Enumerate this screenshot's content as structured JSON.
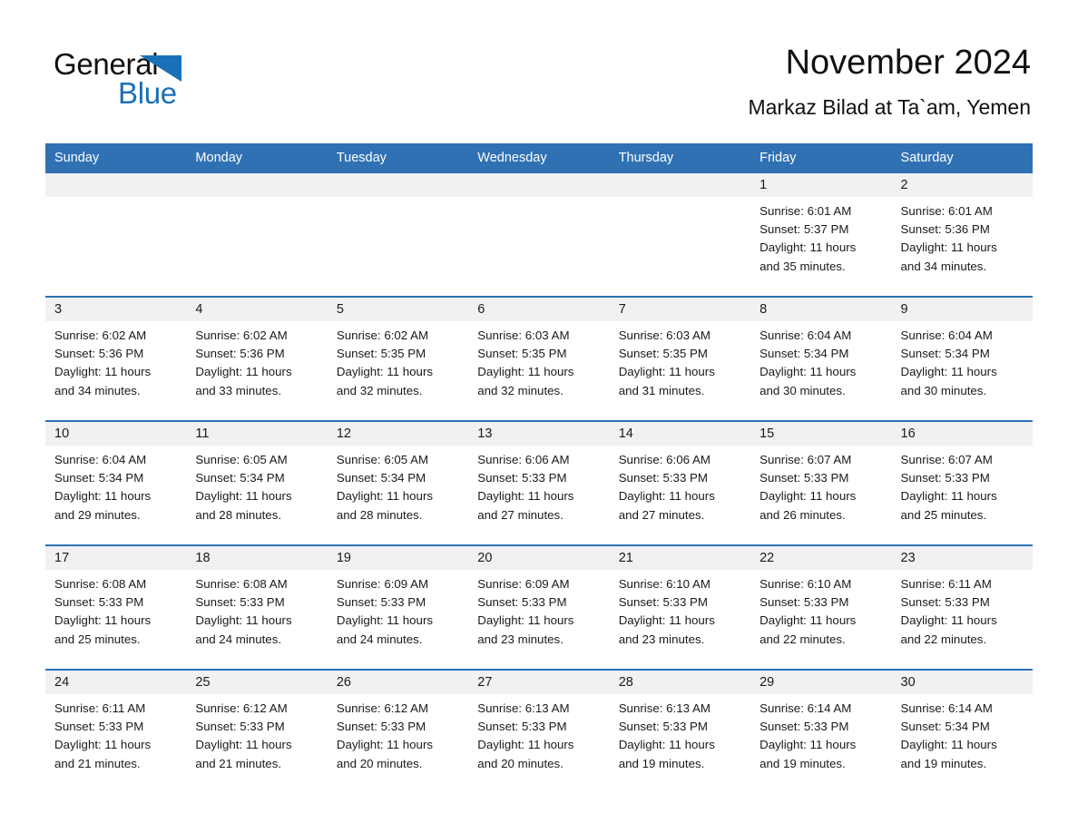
{
  "brand": {
    "name_part1": "General",
    "name_part2": "Blue",
    "triangle_color": "#1a70b8"
  },
  "header": {
    "title": "November 2024",
    "subtitle": "Markaz Bilad at Ta`am, Yemen"
  },
  "colors": {
    "header_blue": "#3071b4",
    "day_band_gray": "#f1f1f1",
    "text": "#1a1a1a"
  },
  "weekdays": [
    "Sunday",
    "Monday",
    "Tuesday",
    "Wednesday",
    "Thursday",
    "Friday",
    "Saturday"
  ],
  "weeks": [
    [
      {
        "day": "",
        "sunrise": "",
        "sunset": "",
        "daylight1": "",
        "daylight2": ""
      },
      {
        "day": "",
        "sunrise": "",
        "sunset": "",
        "daylight1": "",
        "daylight2": ""
      },
      {
        "day": "",
        "sunrise": "",
        "sunset": "",
        "daylight1": "",
        "daylight2": ""
      },
      {
        "day": "",
        "sunrise": "",
        "sunset": "",
        "daylight1": "",
        "daylight2": ""
      },
      {
        "day": "",
        "sunrise": "",
        "sunset": "",
        "daylight1": "",
        "daylight2": ""
      },
      {
        "day": "1",
        "sunrise": "Sunrise: 6:01 AM",
        "sunset": "Sunset: 5:37 PM",
        "daylight1": "Daylight: 11 hours",
        "daylight2": "and 35 minutes."
      },
      {
        "day": "2",
        "sunrise": "Sunrise: 6:01 AM",
        "sunset": "Sunset: 5:36 PM",
        "daylight1": "Daylight: 11 hours",
        "daylight2": "and 34 minutes."
      }
    ],
    [
      {
        "day": "3",
        "sunrise": "Sunrise: 6:02 AM",
        "sunset": "Sunset: 5:36 PM",
        "daylight1": "Daylight: 11 hours",
        "daylight2": "and 34 minutes."
      },
      {
        "day": "4",
        "sunrise": "Sunrise: 6:02 AM",
        "sunset": "Sunset: 5:36 PM",
        "daylight1": "Daylight: 11 hours",
        "daylight2": "and 33 minutes."
      },
      {
        "day": "5",
        "sunrise": "Sunrise: 6:02 AM",
        "sunset": "Sunset: 5:35 PM",
        "daylight1": "Daylight: 11 hours",
        "daylight2": "and 32 minutes."
      },
      {
        "day": "6",
        "sunrise": "Sunrise: 6:03 AM",
        "sunset": "Sunset: 5:35 PM",
        "daylight1": "Daylight: 11 hours",
        "daylight2": "and 32 minutes."
      },
      {
        "day": "7",
        "sunrise": "Sunrise: 6:03 AM",
        "sunset": "Sunset: 5:35 PM",
        "daylight1": "Daylight: 11 hours",
        "daylight2": "and 31 minutes."
      },
      {
        "day": "8",
        "sunrise": "Sunrise: 6:04 AM",
        "sunset": "Sunset: 5:34 PM",
        "daylight1": "Daylight: 11 hours",
        "daylight2": "and 30 minutes."
      },
      {
        "day": "9",
        "sunrise": "Sunrise: 6:04 AM",
        "sunset": "Sunset: 5:34 PM",
        "daylight1": "Daylight: 11 hours",
        "daylight2": "and 30 minutes."
      }
    ],
    [
      {
        "day": "10",
        "sunrise": "Sunrise: 6:04 AM",
        "sunset": "Sunset: 5:34 PM",
        "daylight1": "Daylight: 11 hours",
        "daylight2": "and 29 minutes."
      },
      {
        "day": "11",
        "sunrise": "Sunrise: 6:05 AM",
        "sunset": "Sunset: 5:34 PM",
        "daylight1": "Daylight: 11 hours",
        "daylight2": "and 28 minutes."
      },
      {
        "day": "12",
        "sunrise": "Sunrise: 6:05 AM",
        "sunset": "Sunset: 5:34 PM",
        "daylight1": "Daylight: 11 hours",
        "daylight2": "and 28 minutes."
      },
      {
        "day": "13",
        "sunrise": "Sunrise: 6:06 AM",
        "sunset": "Sunset: 5:33 PM",
        "daylight1": "Daylight: 11 hours",
        "daylight2": "and 27 minutes."
      },
      {
        "day": "14",
        "sunrise": "Sunrise: 6:06 AM",
        "sunset": "Sunset: 5:33 PM",
        "daylight1": "Daylight: 11 hours",
        "daylight2": "and 27 minutes."
      },
      {
        "day": "15",
        "sunrise": "Sunrise: 6:07 AM",
        "sunset": "Sunset: 5:33 PM",
        "daylight1": "Daylight: 11 hours",
        "daylight2": "and 26 minutes."
      },
      {
        "day": "16",
        "sunrise": "Sunrise: 6:07 AM",
        "sunset": "Sunset: 5:33 PM",
        "daylight1": "Daylight: 11 hours",
        "daylight2": "and 25 minutes."
      }
    ],
    [
      {
        "day": "17",
        "sunrise": "Sunrise: 6:08 AM",
        "sunset": "Sunset: 5:33 PM",
        "daylight1": "Daylight: 11 hours",
        "daylight2": "and 25 minutes."
      },
      {
        "day": "18",
        "sunrise": "Sunrise: 6:08 AM",
        "sunset": "Sunset: 5:33 PM",
        "daylight1": "Daylight: 11 hours",
        "daylight2": "and 24 minutes."
      },
      {
        "day": "19",
        "sunrise": "Sunrise: 6:09 AM",
        "sunset": "Sunset: 5:33 PM",
        "daylight1": "Daylight: 11 hours",
        "daylight2": "and 24 minutes."
      },
      {
        "day": "20",
        "sunrise": "Sunrise: 6:09 AM",
        "sunset": "Sunset: 5:33 PM",
        "daylight1": "Daylight: 11 hours",
        "daylight2": "and 23 minutes."
      },
      {
        "day": "21",
        "sunrise": "Sunrise: 6:10 AM",
        "sunset": "Sunset: 5:33 PM",
        "daylight1": "Daylight: 11 hours",
        "daylight2": "and 23 minutes."
      },
      {
        "day": "22",
        "sunrise": "Sunrise: 6:10 AM",
        "sunset": "Sunset: 5:33 PM",
        "daylight1": "Daylight: 11 hours",
        "daylight2": "and 22 minutes."
      },
      {
        "day": "23",
        "sunrise": "Sunrise: 6:11 AM",
        "sunset": "Sunset: 5:33 PM",
        "daylight1": "Daylight: 11 hours",
        "daylight2": "and 22 minutes."
      }
    ],
    [
      {
        "day": "24",
        "sunrise": "Sunrise: 6:11 AM",
        "sunset": "Sunset: 5:33 PM",
        "daylight1": "Daylight: 11 hours",
        "daylight2": "and 21 minutes."
      },
      {
        "day": "25",
        "sunrise": "Sunrise: 6:12 AM",
        "sunset": "Sunset: 5:33 PM",
        "daylight1": "Daylight: 11 hours",
        "daylight2": "and 21 minutes."
      },
      {
        "day": "26",
        "sunrise": "Sunrise: 6:12 AM",
        "sunset": "Sunset: 5:33 PM",
        "daylight1": "Daylight: 11 hours",
        "daylight2": "and 20 minutes."
      },
      {
        "day": "27",
        "sunrise": "Sunrise: 6:13 AM",
        "sunset": "Sunset: 5:33 PM",
        "daylight1": "Daylight: 11 hours",
        "daylight2": "and 20 minutes."
      },
      {
        "day": "28",
        "sunrise": "Sunrise: 6:13 AM",
        "sunset": "Sunset: 5:33 PM",
        "daylight1": "Daylight: 11 hours",
        "daylight2": "and 19 minutes."
      },
      {
        "day": "29",
        "sunrise": "Sunrise: 6:14 AM",
        "sunset": "Sunset: 5:33 PM",
        "daylight1": "Daylight: 11 hours",
        "daylight2": "and 19 minutes."
      },
      {
        "day": "30",
        "sunrise": "Sunrise: 6:14 AM",
        "sunset": "Sunset: 5:34 PM",
        "daylight1": "Daylight: 11 hours",
        "daylight2": "and 19 minutes."
      }
    ]
  ]
}
